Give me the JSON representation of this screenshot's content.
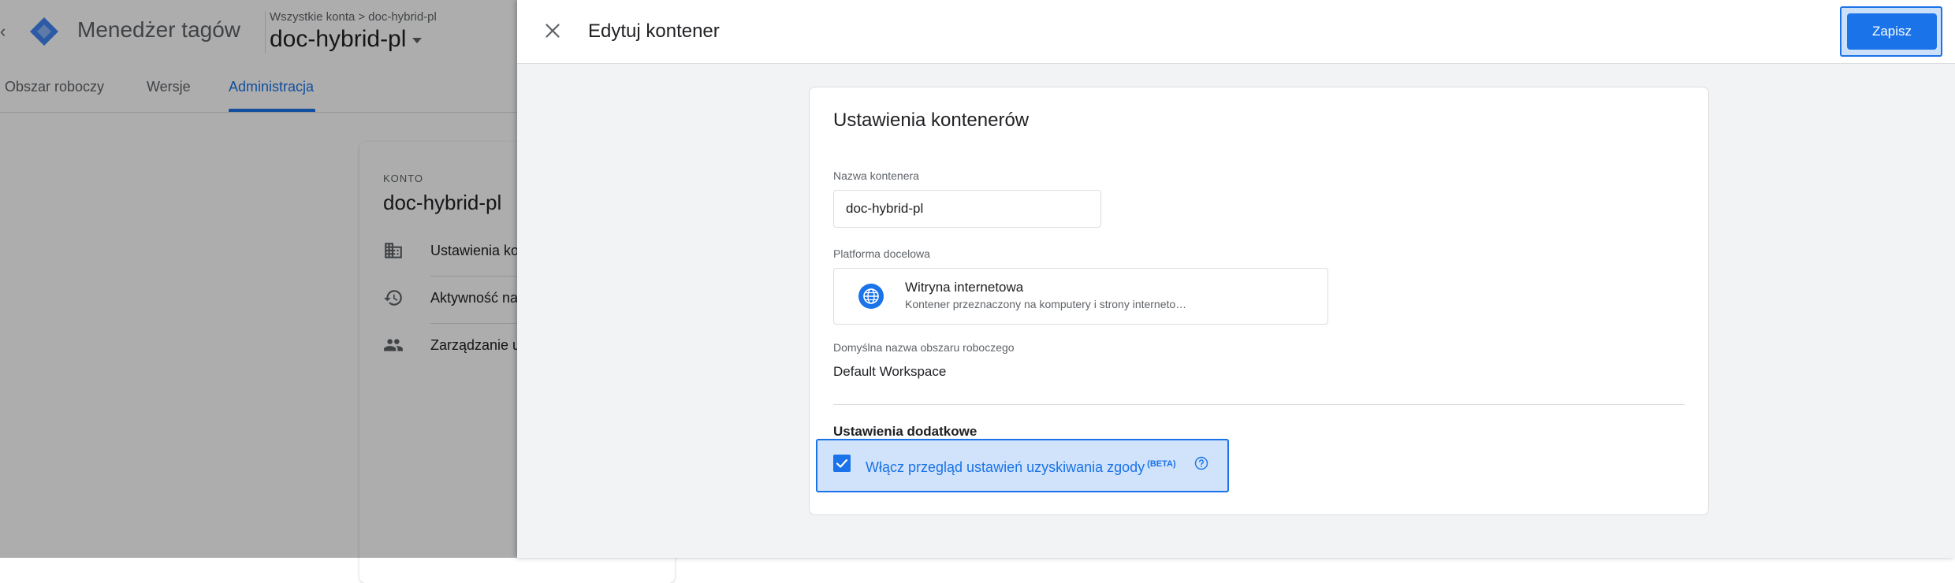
{
  "app": {
    "title": "Menedżer tagów",
    "breadcrumb": {
      "all_accounts": "Wszystkie konta",
      "separator": ">",
      "account": "doc-hybrid-pl"
    },
    "container_name": "doc-hybrid-pl",
    "tabs": [
      {
        "label": "Obszar roboczy"
      },
      {
        "label": "Wersje"
      },
      {
        "label": "Administracja",
        "active": true
      }
    ],
    "admin": {
      "section_label": "KONTO",
      "account_name": "doc-hybrid-pl",
      "items": [
        {
          "label": "Ustawienia ko",
          "icon": "building-icon"
        },
        {
          "label": "Aktywność na",
          "icon": "history-icon"
        },
        {
          "label": "Zarządzanie u",
          "icon": "people-icon"
        }
      ]
    }
  },
  "panel": {
    "title": "Edytuj kontener",
    "save_label": "Zapisz",
    "card": {
      "title": "Ustawienia kontenerów",
      "container_name_label": "Nazwa kontenera",
      "container_name_value": "doc-hybrid-pl",
      "platform_label": "Platforma docelowa",
      "platform_name": "Witryna internetowa",
      "platform_desc": "Kontener przeznaczony na komputery i strony interneto…",
      "workspace_label": "Domyślna nazwa obszaru roboczego",
      "workspace_value": "Default Workspace",
      "additional_label": "Ustawienia dodatkowe",
      "consent_label": "Włącz przegląd ustawień uzyskiwania zgody",
      "consent_badge": "(BETA)",
      "consent_checked": true
    }
  },
  "colors": {
    "accent": "#1a73e8",
    "text": "#202124",
    "muted": "#5f6368",
    "border": "#dadce0"
  }
}
